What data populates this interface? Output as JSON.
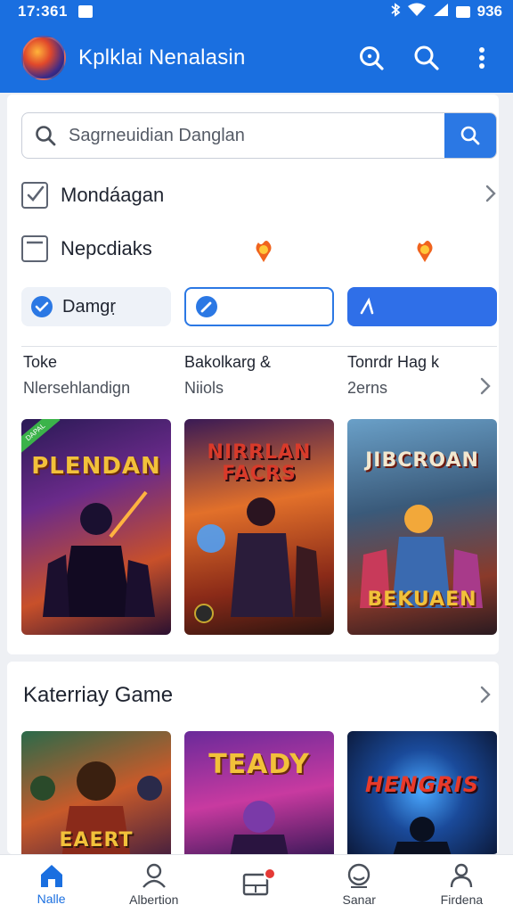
{
  "status_bar": {
    "time": "17:361",
    "battery_text": "936"
  },
  "app_bar": {
    "title": "Kplklai Nenalasin"
  },
  "search": {
    "placeholder": "Sagrneuidian Danglan"
  },
  "menu_rows": [
    {
      "label": "Mondáagan"
    },
    {
      "label": "Nepcdiaks"
    }
  ],
  "filter_chips": [
    {
      "label": "Damgṛ"
    },
    {
      "label": ""
    },
    {
      "label": ""
    }
  ],
  "info_columns": [
    {
      "title": "Toke",
      "subtitle": "Nlersehlandign"
    },
    {
      "title": "Bakolkarg &",
      "subtitle": "Niiols"
    },
    {
      "title": "Tonrdr Hag k",
      "subtitle": "2erns"
    }
  ],
  "featured_games": [
    {
      "title": "PLENDAN",
      "badge": "DAPAL"
    },
    {
      "title": "NIRRLAN FACRS"
    },
    {
      "title": "JIBCROAN",
      "bottom_text": "BEKUAEN"
    }
  ],
  "category_section": {
    "title": "Katerriay Game",
    "games": [
      {
        "title": "EAERT"
      },
      {
        "title": "TEADY"
      },
      {
        "title": "HENGRIS"
      }
    ]
  },
  "bottom_nav": [
    {
      "label": "Nalle",
      "icon": "home-icon"
    },
    {
      "label": "Albertion",
      "icon": "person-icon"
    },
    {
      "label": "",
      "icon": "inbox-icon"
    },
    {
      "label": "Sanar",
      "icon": "face-icon"
    },
    {
      "label": "Firdena",
      "icon": "profile-icon"
    }
  ],
  "colors": {
    "primary": "#1a6fe0",
    "accent": "#2b78e4",
    "badge": "#e53935"
  }
}
